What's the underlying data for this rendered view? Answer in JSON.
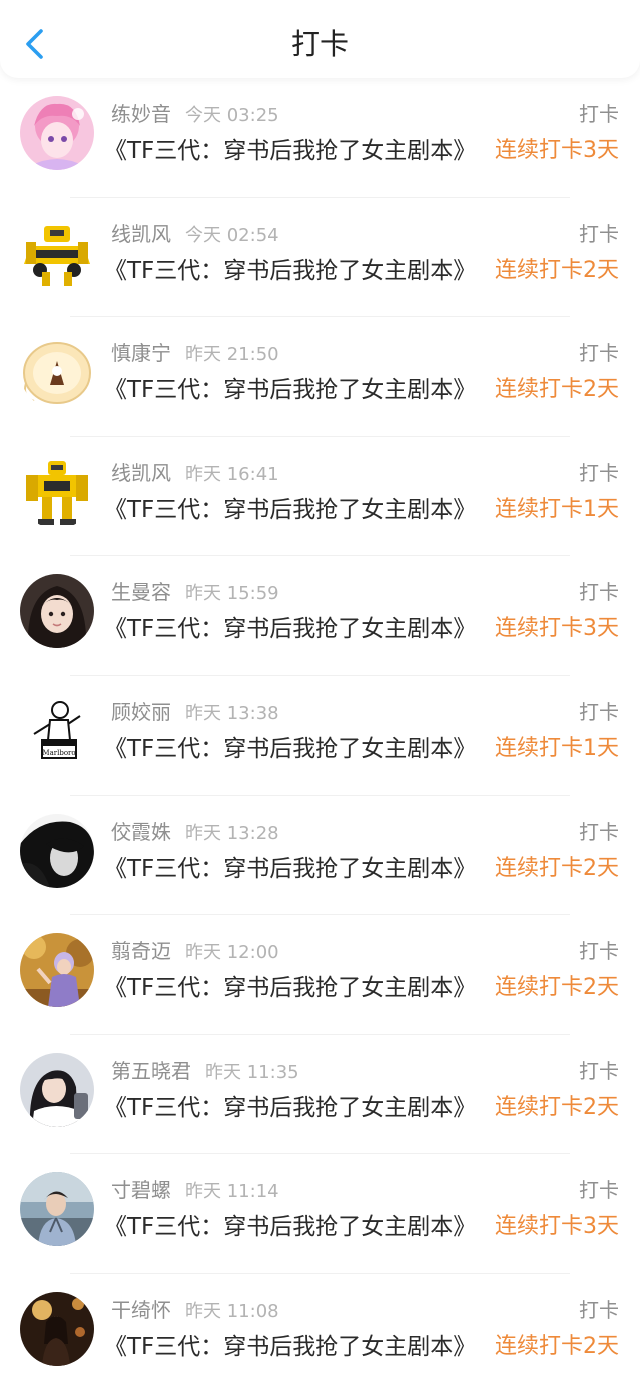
{
  "header": {
    "title": "打卡",
    "back_icon": "chevron-left-icon",
    "accent_color": "#2b9ef0"
  },
  "entries": [
    {
      "name": "练妙音",
      "time": "今天 03:25",
      "action": "打卡",
      "book": "《TF三代：穿书后我抢了女主剧本》",
      "streak": "连续打卡3天",
      "avatar": "anime-pink-hair-avatar"
    },
    {
      "name": "线凯风",
      "time": "今天 02:54",
      "action": "打卡",
      "book": "《TF三代：穿书后我抢了女主剧本》",
      "streak": "连续打卡2天",
      "avatar": "yellow-robot-avatar"
    },
    {
      "name": "慎康宁",
      "time": "昨天 21:50",
      "action": "打卡",
      "book": "《TF三代：穿书后我抢了女主剧本》",
      "streak": "连续打卡2天",
      "avatar": "cartoon-bun-avatar"
    },
    {
      "name": "线凯风",
      "time": "昨天 16:41",
      "action": "打卡",
      "book": "《TF三代：穿书后我抢了女主剧本》",
      "streak": "连续打卡1天",
      "avatar": "yellow-robot-avatar"
    },
    {
      "name": "生曼容",
      "time": "昨天 15:59",
      "action": "打卡",
      "book": "《TF三代：穿书后我抢了女主剧本》",
      "streak": "连续打卡3天",
      "avatar": "girl-photo-avatar"
    },
    {
      "name": "顾姣丽",
      "time": "昨天 13:38",
      "action": "打卡",
      "book": "《TF三代：穿书后我抢了女主剧本》",
      "streak": "连续打卡1天",
      "avatar": "sketch-figure-avatar"
    },
    {
      "name": "佼霞姝",
      "time": "昨天 13:28",
      "action": "打卡",
      "book": "《TF三代：穿书后我抢了女主剧本》",
      "streak": "连续打卡2天",
      "avatar": "dark-portrait-avatar"
    },
    {
      "name": "翦奇迈",
      "time": "昨天 12:00",
      "action": "打卡",
      "book": "《TF三代：穿书后我抢了女主剧本》",
      "streak": "连续打卡2天",
      "avatar": "autumn-girl-avatar"
    },
    {
      "name": "第五晓君",
      "time": "昨天 11:35",
      "action": "打卡",
      "book": "《TF三代：穿书后我抢了女主剧本》",
      "streak": "连续打卡2天",
      "avatar": "girl-selfie-avatar"
    },
    {
      "name": "寸碧螺",
      "time": "昨天 11:14",
      "action": "打卡",
      "book": "《TF三代：穿书后我抢了女主剧本》",
      "streak": "连续打卡3天",
      "avatar": "boy-photo-avatar"
    },
    {
      "name": "干绮怀",
      "time": "昨天 11:08",
      "action": "打卡",
      "book": "《TF三代：穿书后我抢了女主剧本》",
      "streak": "连续打卡2天",
      "avatar": "night-street-avatar"
    }
  ],
  "colors": {
    "name": "#8f8f8f",
    "time": "#b3b3b3",
    "book": "#2b2b2b",
    "streak": "#ee8a3a"
  }
}
